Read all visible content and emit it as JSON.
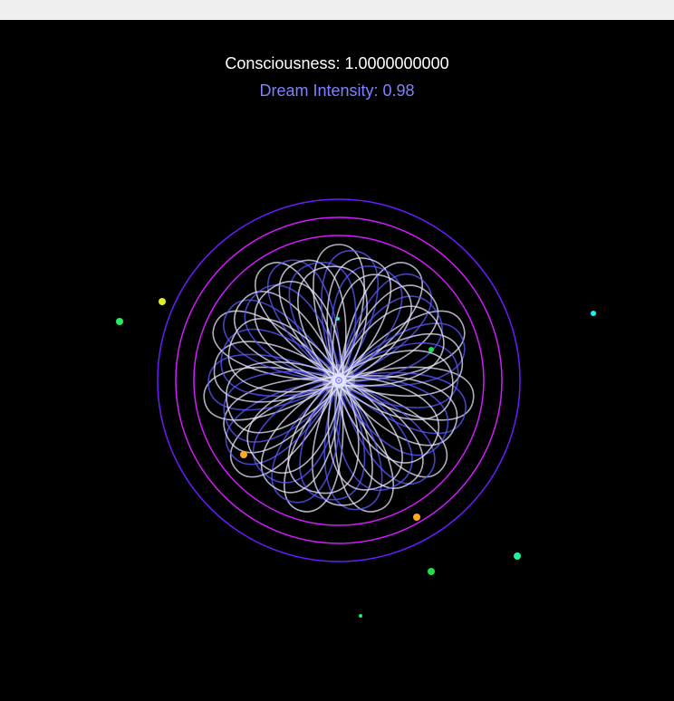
{
  "readouts": {
    "consciousness_text": "Consciousness: 1.0000000000",
    "dream_text": "Dream Intensity: 0.98"
  },
  "colors": {
    "background": "#000000",
    "topbar": "#f0f0f0",
    "consciousness": "#ffffff",
    "dream": "#8080ff",
    "ring_outer": "#6a1bff",
    "ring_inner": "#d21aff",
    "flower_light": "#e8e8ff",
    "flower_blue": "#5a5aff"
  },
  "particle_colors": [
    "#22ee66",
    "#ddee22",
    "#22eeee",
    "#ffaa22",
    "#22ee99",
    "#22dd44"
  ]
}
